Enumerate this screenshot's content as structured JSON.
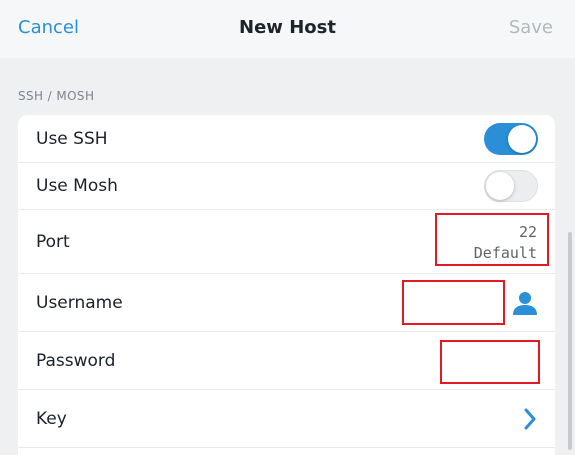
{
  "nav": {
    "cancel_label": "Cancel",
    "title": "New Host",
    "save_label": "Save"
  },
  "section": {
    "header": "SSH / MOSH"
  },
  "rows": {
    "use_ssh": {
      "label": "Use SSH",
      "enabled": true
    },
    "use_mosh": {
      "label": "Use Mosh",
      "enabled": false
    },
    "port": {
      "label": "Port",
      "value": "22",
      "hint": "Default"
    },
    "username": {
      "label": "Username",
      "icon": "user-icon"
    },
    "password": {
      "label": "Password"
    },
    "key": {
      "label": "Key",
      "icon": "chevron-right-icon"
    }
  },
  "colors": {
    "accent": "#2a8fd6",
    "redaction": "#e01b24"
  }
}
